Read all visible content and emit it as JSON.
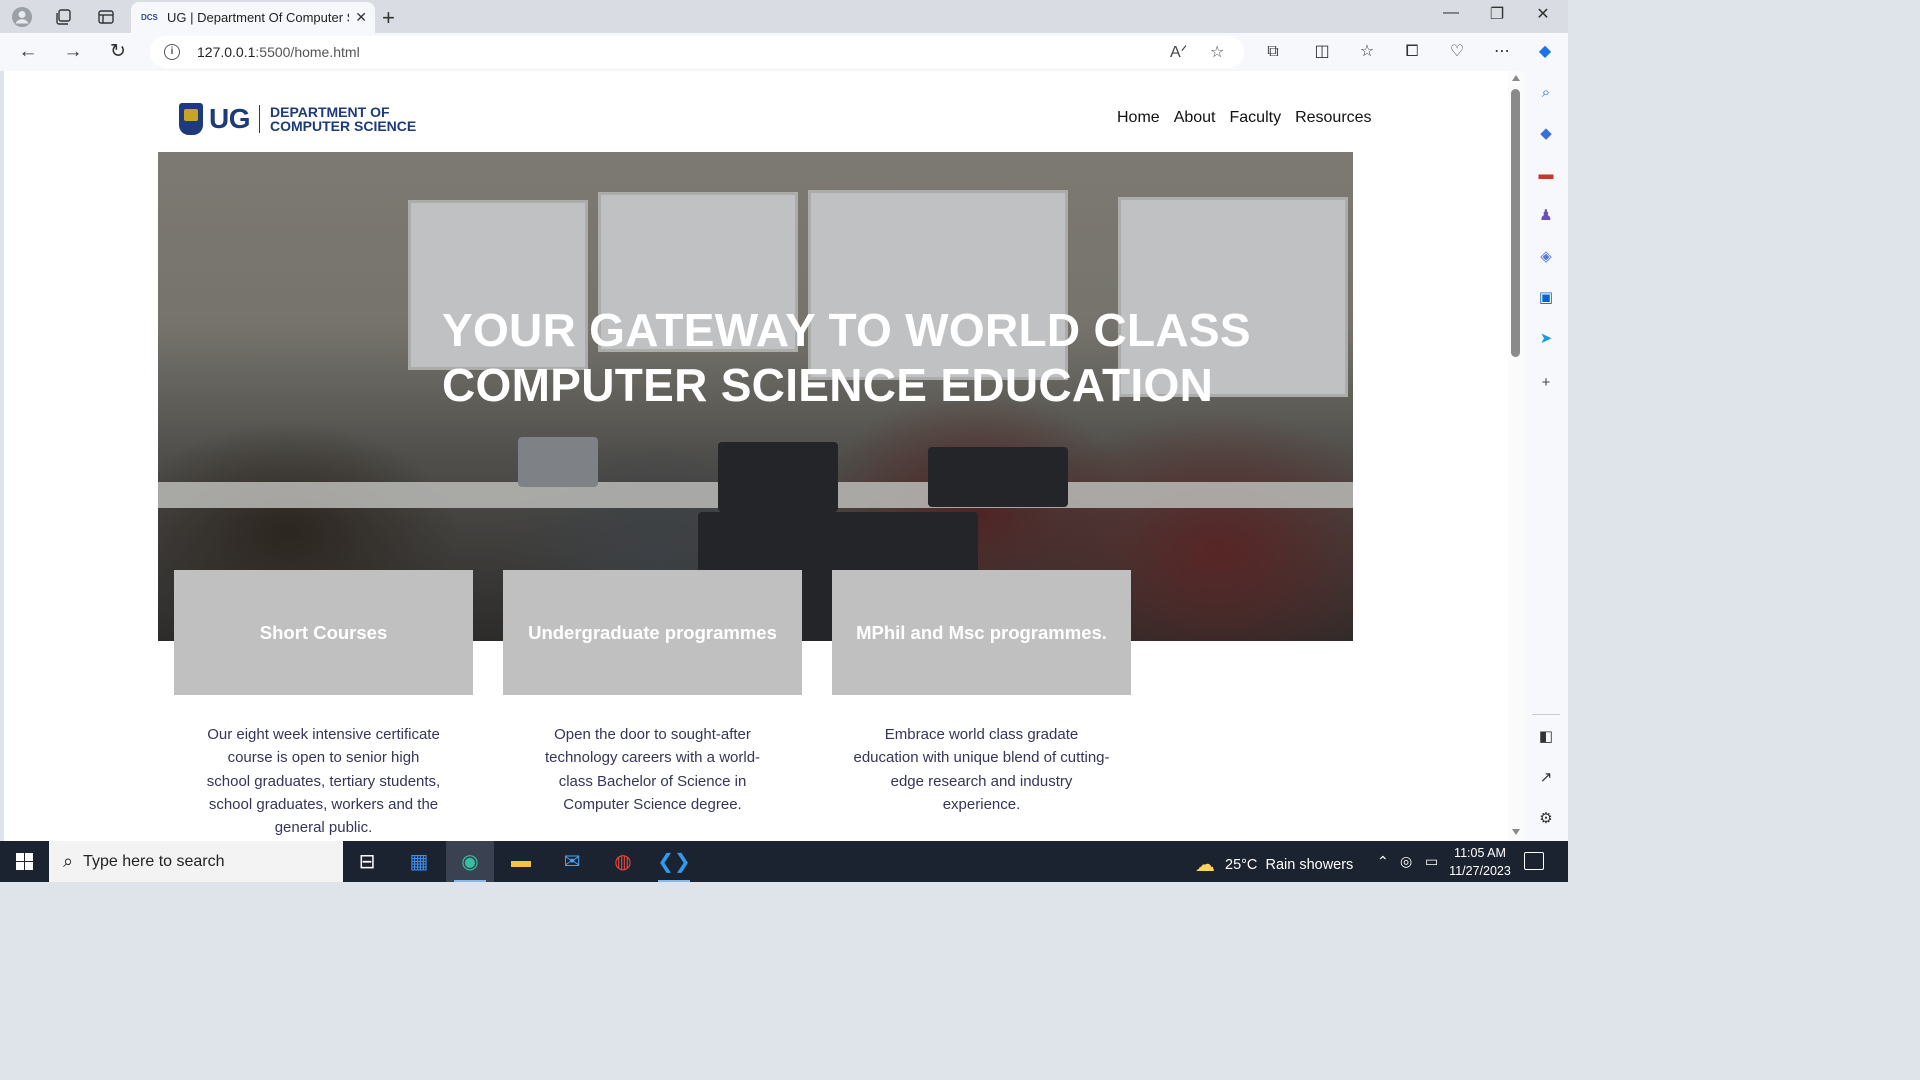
{
  "browser": {
    "tab_title": "UG | Department Of Computer Science",
    "tab_favicon_text": "DCS",
    "url_host": "127.0.0.1",
    "url_path": ":5500/home.html"
  },
  "page": {
    "logo_ug": "UG",
    "logo_dept_line1": "DEPARTMENT OF",
    "logo_dept_line2": "COMPUTER SCIENCE",
    "nav": [
      "Home",
      "About",
      "Faculty",
      "Resources"
    ],
    "hero_line1": "YOUR GATEWAY TO WORLD CLASS",
    "hero_line2": "COMPUTER SCIENCE EDUCATION",
    "cards": [
      {
        "title": "Short Courses",
        "description": "Our eight week intensive certificate course is open to senior high school graduates, tertiary students, school graduates, workers and the general public."
      },
      {
        "title": "Undergraduate programmes",
        "description": "Open the door to sought-after technology careers with a world-class Bachelor of Science in Computer Science degree."
      },
      {
        "title": "MPhil and Msc programmes.",
        "description": "Embrace world class gradate education with unique blend of cutting-edge research and industry experience."
      }
    ]
  },
  "taskbar": {
    "search_placeholder": "Type here to search",
    "weather_temp": "25°C",
    "weather_desc": "Rain showers",
    "time": "11:05 AM",
    "date": "11/27/2023"
  },
  "colors": {
    "brand_navy": "#1d3a7a",
    "card_gray": "#c0c0c0",
    "taskbar_bg": "#1c2330"
  }
}
